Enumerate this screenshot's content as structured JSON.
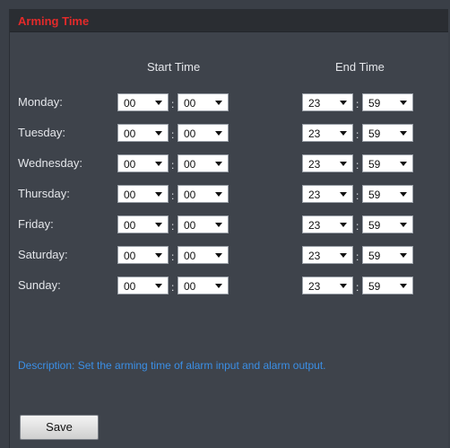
{
  "panel": {
    "title": "Arming Time",
    "start_header": "Start Time",
    "end_header": "End Time"
  },
  "days": [
    {
      "label": "Monday:",
      "start_hour": "00",
      "start_min": "00",
      "end_hour": "23",
      "end_min": "59"
    },
    {
      "label": "Tuesday:",
      "start_hour": "00",
      "start_min": "00",
      "end_hour": "23",
      "end_min": "59"
    },
    {
      "label": "Wednesday:",
      "start_hour": "00",
      "start_min": "00",
      "end_hour": "23",
      "end_min": "59"
    },
    {
      "label": "Thursday:",
      "start_hour": "00",
      "start_min": "00",
      "end_hour": "23",
      "end_min": "59"
    },
    {
      "label": "Friday:",
      "start_hour": "00",
      "start_min": "00",
      "end_hour": "23",
      "end_min": "59"
    },
    {
      "label": "Saturday:",
      "start_hour": "00",
      "start_min": "00",
      "end_hour": "23",
      "end_min": "59"
    },
    {
      "label": "Sunday:",
      "start_hour": "00",
      "start_min": "00",
      "end_hour": "23",
      "end_min": "59"
    }
  ],
  "separator": ":",
  "description": "Description: Set the arming time of alarm input and alarm output.",
  "save_label": "Save",
  "colors": {
    "title": "#e32a2a",
    "description": "#3b8fe6",
    "background": "#3e434b"
  }
}
